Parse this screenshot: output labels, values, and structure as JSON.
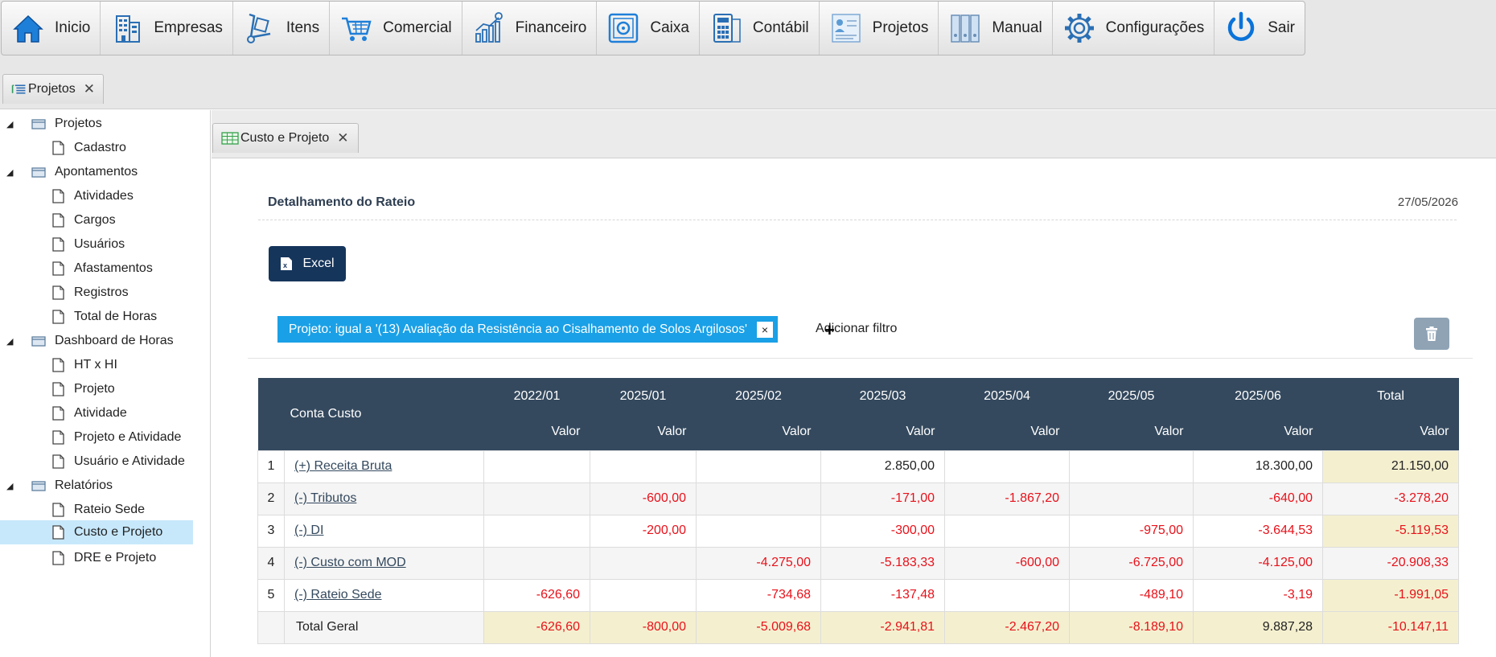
{
  "menu": {
    "items": [
      {
        "label": "Inicio",
        "icon": "home-icon"
      },
      {
        "label": "Empresas",
        "icon": "building-icon"
      },
      {
        "label": "Itens",
        "icon": "hand-truck-icon"
      },
      {
        "label": "Comercial",
        "icon": "shopping-cart-icon"
      },
      {
        "label": "Financeiro",
        "icon": "finance-chart-icon"
      },
      {
        "label": "Caixa",
        "icon": "safe-icon"
      },
      {
        "label": "Contábil",
        "icon": "calculator-icon"
      },
      {
        "label": "Projetos",
        "icon": "project-icon"
      },
      {
        "label": "Manual",
        "icon": "binders-icon"
      },
      {
        "label": "Configurações",
        "icon": "gear-icon"
      },
      {
        "label": "Sair",
        "icon": "power-icon"
      }
    ]
  },
  "outer_tab": {
    "label": "Projetos",
    "icon": "tree-list-icon",
    "close": "✕"
  },
  "sidebar": {
    "groups": [
      {
        "label": "Projetos",
        "items": [
          "Cadastro"
        ]
      },
      {
        "label": "Apontamentos",
        "items": [
          "Atividades",
          "Cargos",
          "Usuários",
          "Afastamentos",
          "Registros",
          "Total de Horas"
        ]
      },
      {
        "label": "Dashboard de Horas",
        "items": [
          "HT x HI",
          "Projeto",
          "Atividade",
          "Projeto e Atividade",
          "Usuário e Atividade"
        ]
      },
      {
        "label": "Relatórios",
        "items": [
          "Rateio Sede",
          "Custo e Projeto",
          "DRE e Projeto"
        ]
      }
    ],
    "selected": "Custo e Projeto",
    "expand_glyph": "◢"
  },
  "inner_tab": {
    "label": "Custo e Projeto",
    "icon": "grid-table-icon",
    "close": "✕"
  },
  "report": {
    "title": "Detalhamento do Rateio",
    "date": "27/05/2026",
    "excel_label": "Excel",
    "filter_text": "Projeto: igual a '(13) Avaliação da Resistência ao Cisalhamento de Solos Argilosos'",
    "filter_close": "×",
    "add_filter": "Adicionar filtro",
    "cursor_glyph": "+"
  },
  "table": {
    "account_header": "Conta Custo",
    "periods": [
      "2022/01",
      "2025/01",
      "2025/02",
      "2025/03",
      "2025/04",
      "2025/05",
      "2025/06",
      "Total"
    ],
    "sub_header": "Valor",
    "rows": [
      {
        "n": "1",
        "account": "(+) Receita Bruta",
        "values": [
          "",
          "",
          "",
          "2.850,00",
          "",
          "",
          "18.300,00",
          "21.150,00"
        ]
      },
      {
        "n": "2",
        "account": "(-) Tributos",
        "values": [
          "",
          "-600,00",
          "",
          "-171,00",
          "-1.867,20",
          "",
          "-640,00",
          "-3.278,20"
        ]
      },
      {
        "n": "3",
        "account": "(-) DI",
        "values": [
          "",
          "-200,00",
          "",
          "-300,00",
          "",
          "-975,00",
          "-3.644,53",
          "-5.119,53"
        ]
      },
      {
        "n": "4",
        "account": "(-) Custo com MOD",
        "values": [
          "",
          "",
          "-4.275,00",
          "-5.183,33",
          "-600,00",
          "-6.725,00",
          "-4.125,00",
          "-20.908,33"
        ]
      },
      {
        "n": "5",
        "account": "(-) Rateio Sede",
        "values": [
          "-626,60",
          "",
          "-734,68",
          "-137,48",
          "",
          "-489,10",
          "-3,19",
          "-1.991,05"
        ]
      }
    ],
    "footer": {
      "label": "Total Geral",
      "values": [
        "-626,60",
        "-800,00",
        "-5.009,68",
        "-2.941,81",
        "-2.467,20",
        "-8.189,10",
        "9.887,28",
        "-10.147,11"
      ]
    }
  },
  "colors": {
    "header_bg": "#34495e",
    "negative": "#e8111a",
    "total_bg": "#f4f0cf",
    "selected_bg": "#c7e8fb",
    "chip_bg": "#1aa0e6",
    "excel_bg": "#16355b"
  }
}
